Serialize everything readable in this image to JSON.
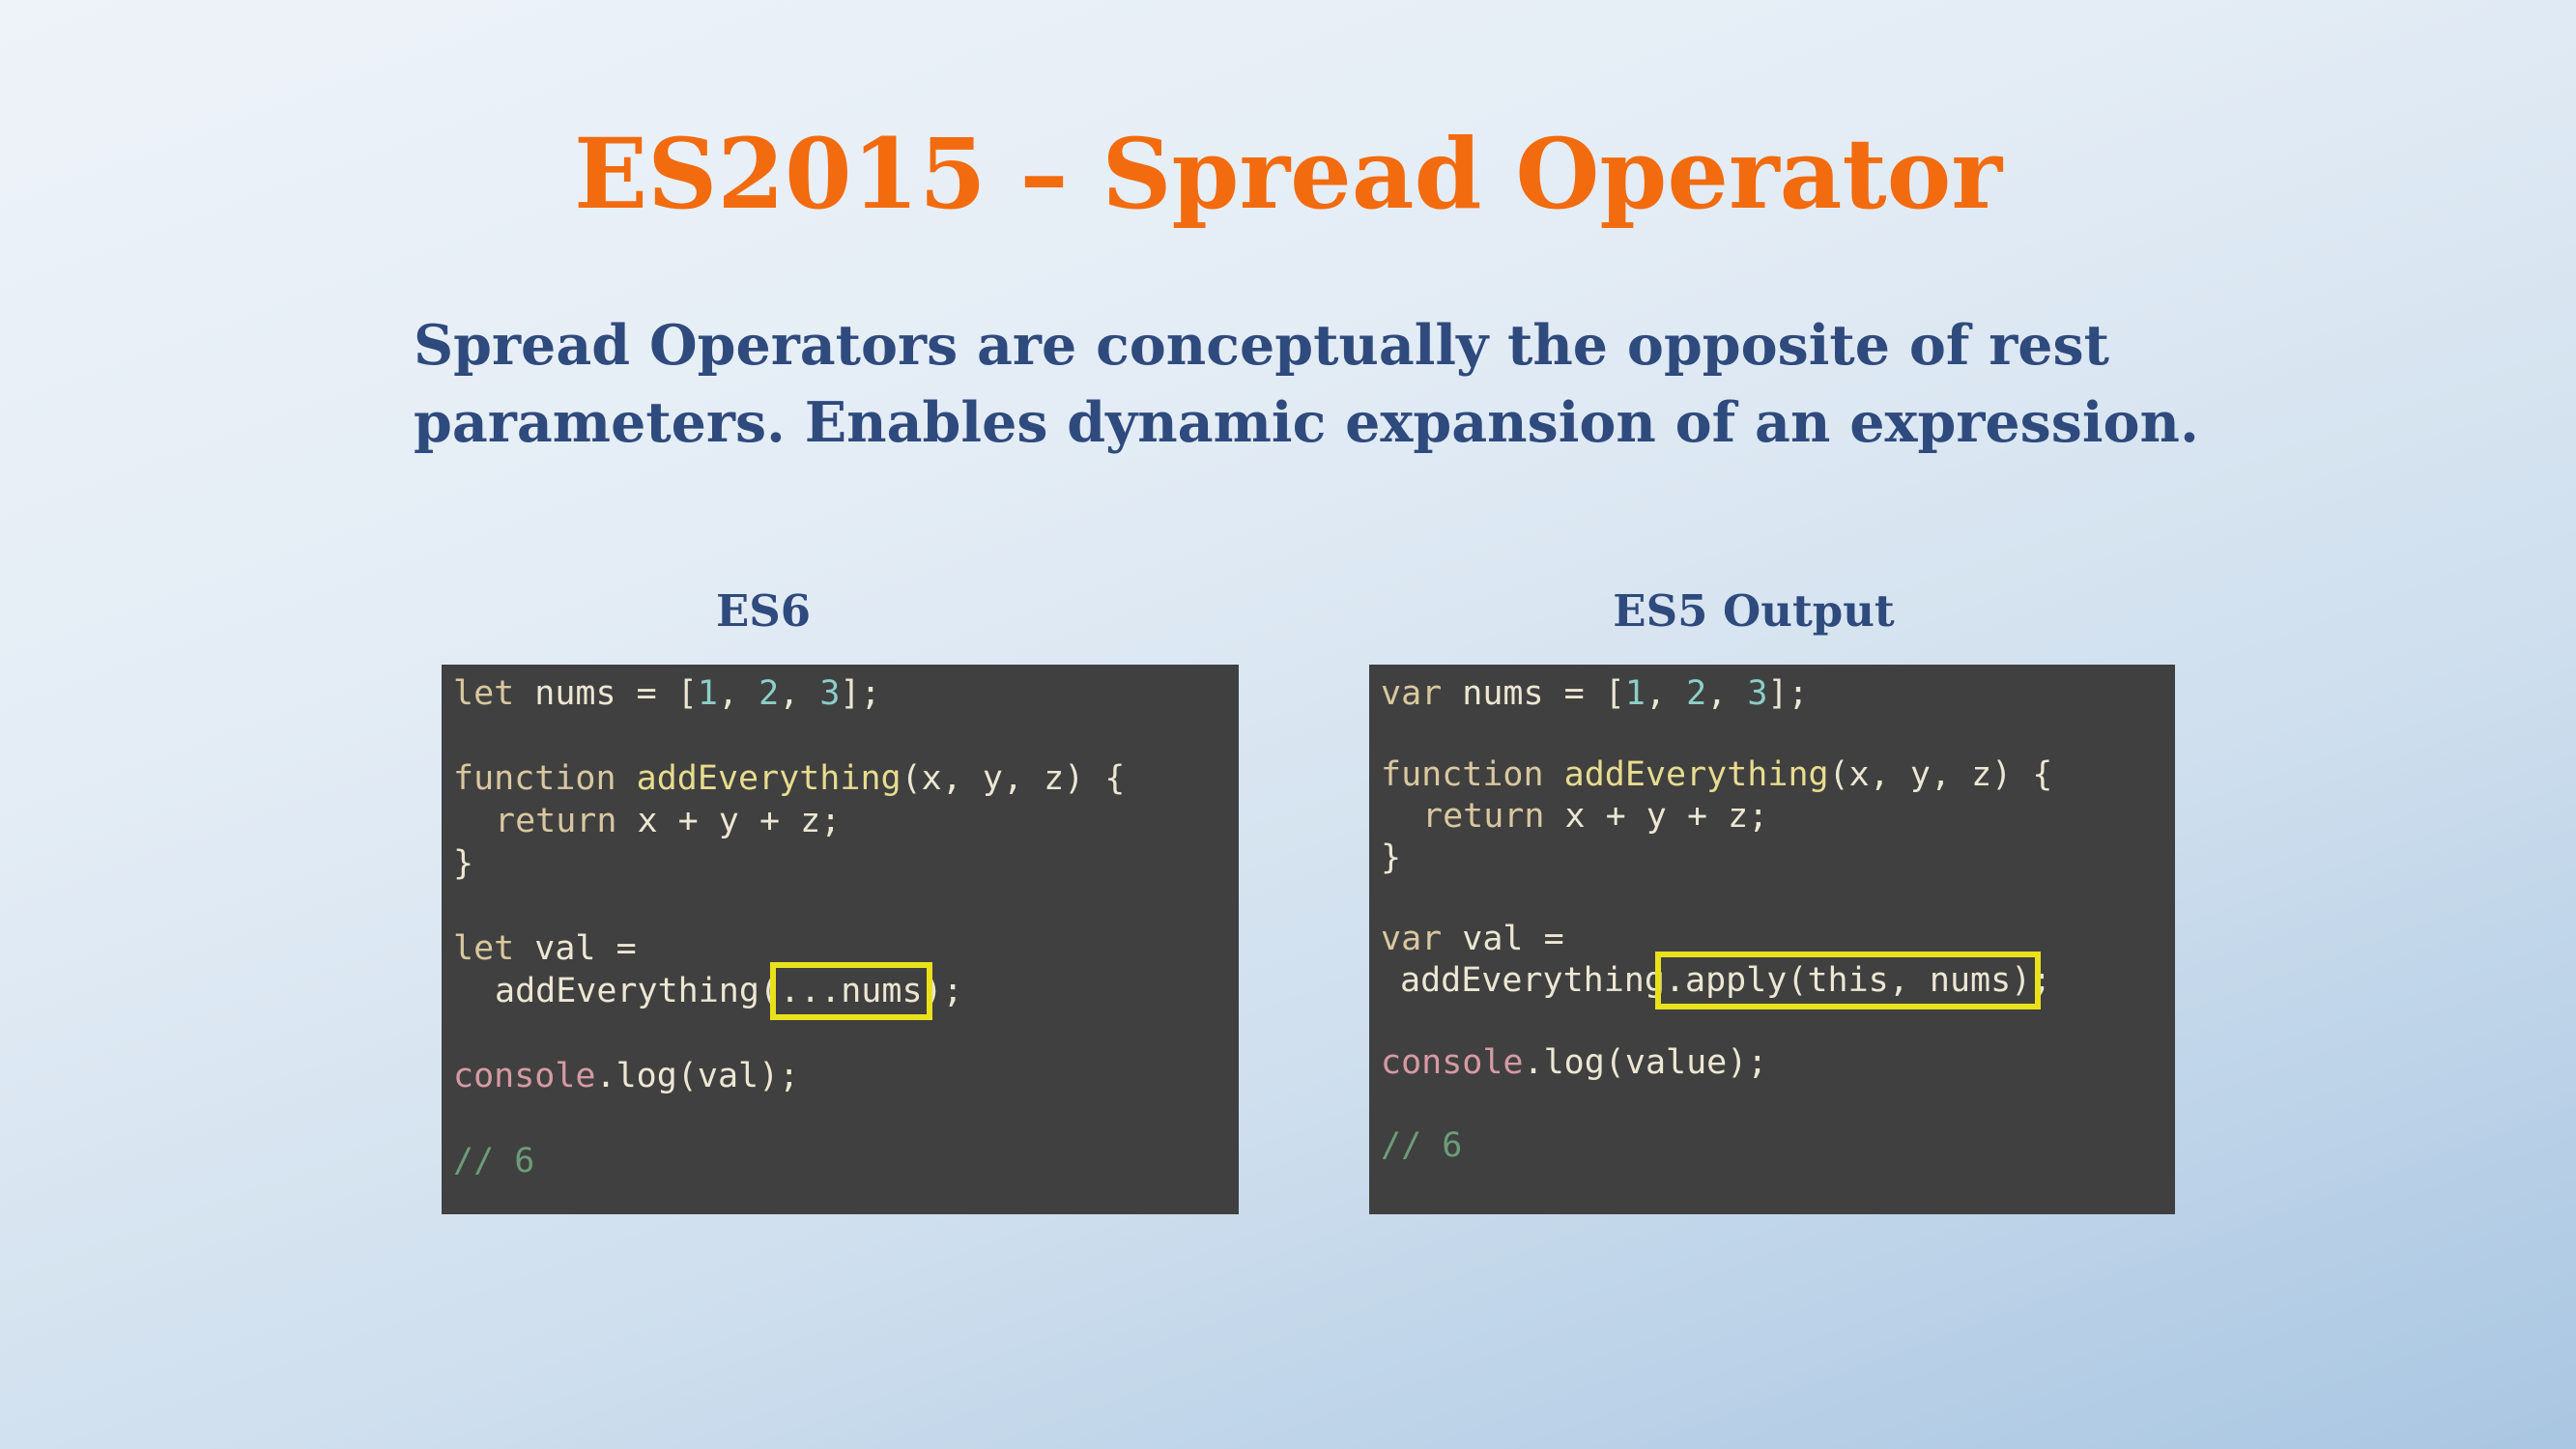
{
  "slide": {
    "title": "ES2015 – Spread Operator",
    "body_line1": "Spread Operators are conceptually the opposite of rest",
    "body_line2": "parameters. Enables dynamic expansion of an expression."
  },
  "colors": {
    "title": "#f26b0f",
    "body_text": "#2f4a7d",
    "code_background": "#404040",
    "highlight_box": "#e9e21a"
  },
  "es6_panel": {
    "label": "ES6",
    "l1_kw": "let",
    "l1_a": " nums = [",
    "l1_n1": "1",
    "l1_b": ", ",
    "l1_n2": "2",
    "l1_c": ", ",
    "l1_n3": "3",
    "l1_d": "];",
    "l2_kw": "function",
    "l2_sp": " ",
    "l2_fn": "addEverything",
    "l2_rest": "(x, y, z) {",
    "l3_kw": "return",
    "l3_rest": " x + y + z;",
    "l4": "}",
    "l5_kw": "let",
    "l5_rest": " val =",
    "l6_a": "addEverything(",
    "l6_hl": "...nums",
    "l6_b": ");",
    "l7_cons": "console",
    "l7_rest": ".log(val);",
    "l8_cmt": "// 6"
  },
  "es5_panel": {
    "label": "ES5 Output",
    "l1_kw": "var",
    "l1_a": " nums = [",
    "l1_n1": "1",
    "l1_b": ", ",
    "l1_n2": "2",
    "l1_c": ", ",
    "l1_n3": "3",
    "l1_d": "];",
    "l2_kw": "function",
    "l2_sp": " ",
    "l2_fn": "addEverything",
    "l2_rest": "(x, y, z) {",
    "l3_kw": "return",
    "l3_rest": " x + y + z;",
    "l4": "}",
    "l5_kw": "var",
    "l5_rest": " val =",
    "l6_a": "addEverything",
    "l6_hl": ".apply(this, nums)",
    "l6_b": ";",
    "l7_cons": "console",
    "l7_rest": ".log(value);",
    "l8_cmt": "// 6"
  }
}
